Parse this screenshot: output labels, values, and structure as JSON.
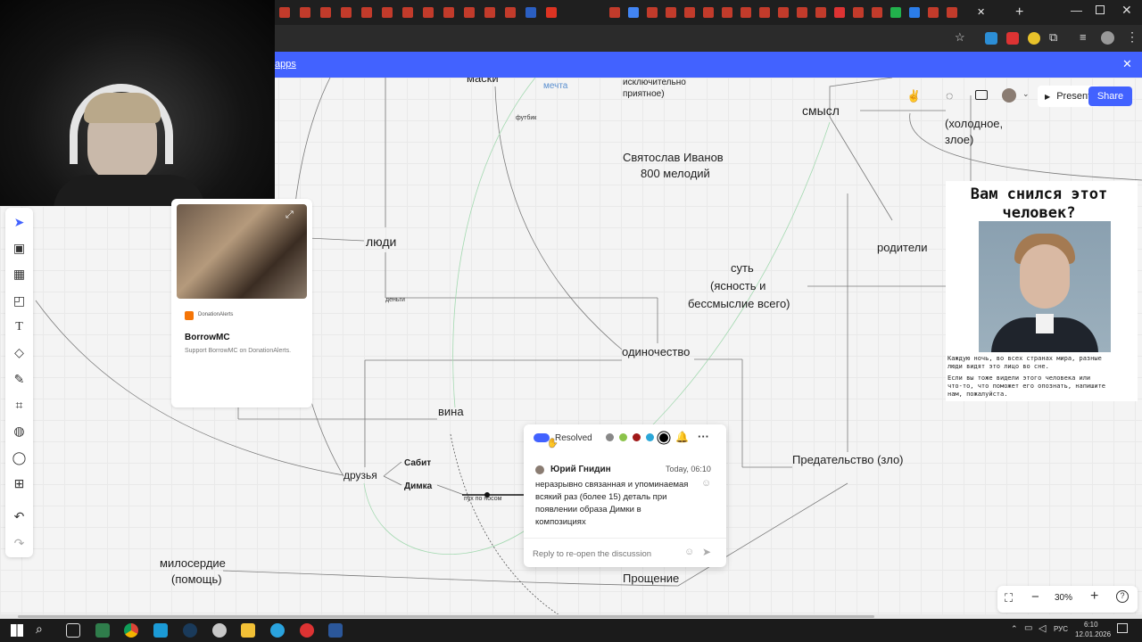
{
  "browser": {
    "banner_text": "apps",
    "close_icon": "close-icon"
  },
  "collab": {
    "present_label": "Present",
    "share_label": "Share"
  },
  "donation": {
    "brand": "DonationAlerts",
    "name": "BorrowMC",
    "desc": "Support BorrowMC on DonationAlerts."
  },
  "nodes": {
    "maski": "маски",
    "mechta": "мечта",
    "futbik": "футбик",
    "iskl1": "исключительно",
    "iskl2": "приятное)",
    "smysl": "смысл",
    "holod1": "(холодное,",
    "holod2": "злое)",
    "svyat1": "Святослав Иванов",
    "svyat2": "800 мелодий",
    "lyudi": "люди",
    "roditeli": "родители",
    "sut1": "суть",
    "sut2": "(ясность и",
    "sut3": "бессмыслие всего)",
    "dengi": "деньги",
    "odinochestvo": "одиночество",
    "vina": "вина",
    "sabit": "Сабит",
    "dimka": "Димка",
    "druzya": "друзья",
    "puh": "пух по носом",
    "predatelstvo": "Предательство (зло)",
    "miloserdie1": "милосердие",
    "miloserdie2": "(помощь)",
    "proschenie": "Прощение"
  },
  "comment": {
    "resolved_label": "Resolved",
    "author": "Юрий Гнидин",
    "time": "Today, 06:10",
    "text1": "неразрывно связанная и упоминаемая",
    "text2": "всякий раз (более 15) деталь при",
    "text3": "появлении образа Димки в",
    "text4": "композициях",
    "reply_placeholder": "Reply to re-open the discussion",
    "colors": [
      "#888888",
      "#8bc34a",
      "#a01818",
      "#2ba7d8",
      "#000000"
    ]
  },
  "meme": {
    "title1": "Вам снился этот",
    "title2": "человек?",
    "p1a": "Каждую ночь, во всех странах мира, разные",
    "p1b": "люди видят это лицо во сне.",
    "p2a": "Если вы тоже видели этого человека или",
    "p2b": "что-то, что поможет его опознать, напишите",
    "p2c": "нам, пожалуйста."
  },
  "zoom": {
    "level": "30%"
  },
  "taskbar": {
    "lang": "РУС",
    "time": "6:10",
    "date": "12.01.2026"
  },
  "colors": {
    "accent": "#4262ff"
  }
}
